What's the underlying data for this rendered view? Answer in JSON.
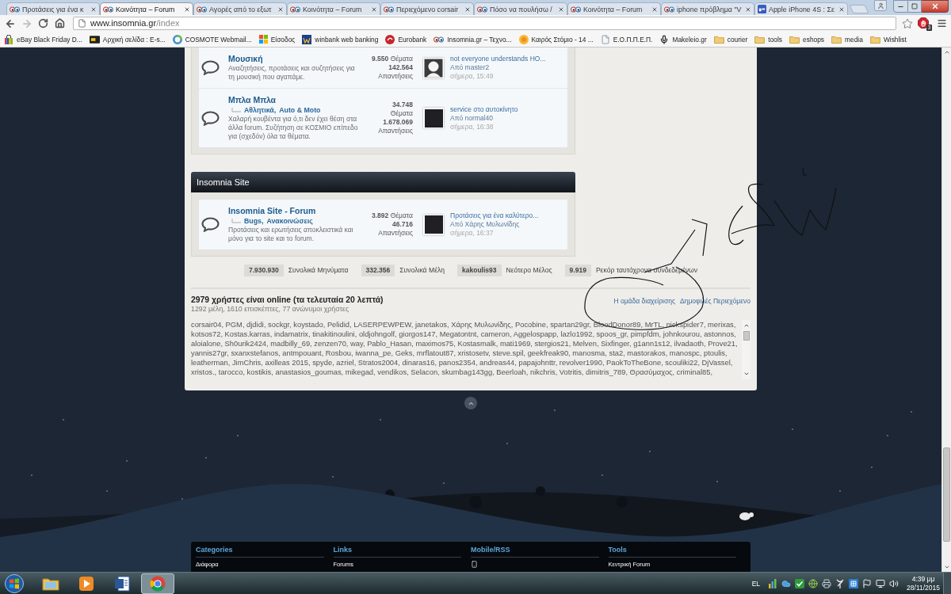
{
  "browser": {
    "tabs": [
      {
        "title": "Προτάσεις για ένα κ",
        "selected": false
      },
      {
        "title": "Κοινότητα – Forum",
        "selected": true
      },
      {
        "title": "Αγορές από το εξωτ",
        "selected": false
      },
      {
        "title": "Κοινότητα – Forum",
        "selected": false
      },
      {
        "title": "Περιεχόμενο corsair",
        "selected": false
      },
      {
        "title": "Πόσο να πουλήσω /",
        "selected": false
      },
      {
        "title": "Κοινότητα – Forum",
        "selected": false
      },
      {
        "title": "iphone πρόβλημα \"V",
        "selected": false
      },
      {
        "title": "Apple iPhone 4S : Σε",
        "selected": false
      }
    ],
    "address": {
      "host": "www.insomnia.gr",
      "path": "/index"
    },
    "extension_badge": "3",
    "bookmarks": [
      {
        "label": "eBay Black Friday D...",
        "kind": "link"
      },
      {
        "label": "Αρχική σελίδα : E-s...",
        "kind": "link"
      },
      {
        "label": "COSMOTE Webmail...",
        "kind": "link"
      },
      {
        "label": "Είσοδος",
        "kind": "link"
      },
      {
        "label": "winbank web banking",
        "kind": "link"
      },
      {
        "label": "Eurobank",
        "kind": "link"
      },
      {
        "label": "Insomnia.gr – Τεχνο...",
        "kind": "link"
      },
      {
        "label": "Καιρός Στόμιο - 14 ...",
        "kind": "link"
      },
      {
        "label": "Ε.Ο.Π.Π.Ε.Π.",
        "kind": "link"
      },
      {
        "label": "Makeleio.gr",
        "kind": "link"
      },
      {
        "label": "courier",
        "kind": "folder"
      },
      {
        "label": "tools",
        "kind": "folder"
      },
      {
        "label": "eshops",
        "kind": "folder"
      },
      {
        "label": "media",
        "kind": "folder"
      },
      {
        "label": "Wishlist",
        "kind": "folder"
      }
    ]
  },
  "forum_groups": [
    {
      "forums": [
        {
          "title": "Μουσική",
          "description": "Αναζητήσεις, προτάσεις και συζητήσεις για τη μουσική που αγαπάμε.",
          "topics": "**9.550** Θέματα",
          "replies": "**142.564** Απαντήσεις",
          "last_post": {
            "kind": "silhouette",
            "title": "not everyone understands HO...",
            "author": "Από master2",
            "time": "σήμερα, 15:49"
          }
        },
        {
          "title": "Μπλα Μπλα",
          "subforums": [
            "Αθλητικά,",
            "Auto & Moto"
          ],
          "description": "Χαλαρή κουβέντα για ό,τι δεν έχει θέση στα άλλα forum. Συζήτηση σε ΚΟΣΜΙΟ επίπεδο για (σχεδόν) όλα τα θέματα.",
          "topics": "**34.748** Θέματα",
          "replies": "**1.678.069** Απαντήσεις",
          "last_post": {
            "kind": "photo",
            "title": "service στο αυτοκίνητο",
            "author": "Από normal40",
            "time": "σήμερα, 16:38"
          }
        }
      ]
    },
    {
      "title": "Insomnia Site",
      "forums": [
        {
          "title": "Insomnia Site - Forum",
          "subforums": [
            "Bugs,",
            "Ανακοινώσεις"
          ],
          "description": "Προτάσεις και ερωτήσεις αποκλειστικά και μόνο για το site και το forum.",
          "topics": "**3.892** Θέματα",
          "replies": "**46.716** Απαντήσεις",
          "last_post": {
            "kind": "photo",
            "title": "Προτάσεις για ένα καλύτερο...",
            "author": "Από Χάρης Μυλωνίδης",
            "time": "σήμερα, 16:37"
          }
        }
      ]
    }
  ],
  "stats": [
    {
      "value": "7.930.930",
      "label": "Συνολικά Μηνύματα"
    },
    {
      "value": "332.356",
      "label": "Συνολικά Μέλη"
    },
    {
      "value": "kakoulis93",
      "label": "Νεότερο Μέλος"
    },
    {
      "value": "9.919",
      "label": "Ρεκόρ ταυτόχρονα συνδεδεμένων"
    }
  ],
  "online": {
    "title": "2979 χρήστες είναι online (τα τελευταία 20 λεπτά)",
    "summary": "1292 μέλη, 1610 επισκέπτες, 77 ανώνυμοι χρήστες",
    "links": [
      "Η ομάδα διαχείρισης",
      "Δημοφιλές Περιεχόμενο"
    ],
    "users": "corsair04, PGM, djdidi, sockgr, koystado, Pelidid, LASERPEWPEW, janetakos, Χάρης Μυλωνίδης, Pocobine, spartan29gr, BloodDonor89, MrTL, nickspider7, merixas, kotsos72, Kostas.karras, indamatrix, tinakitinoulini, oldjohngolf, giorgos147, Megatontnt, cameron, Aggelospapp, lazlo1992, spoos_gr, pimpfdm, johnkourou, astonnos, aloialone, Sh0urik2424, madbilly_69, zenzen70, way, Pablo_Hasan, maximos75, Kostasmalk, mati1969, stergios21, Melven, Sixfinger, g1ann1s12, ilvadaoth, Prove21, yannis27gr, sxanxstefanos, antmpouant, Rosbou, iwanna_pe, Geks, mrflatout87, xristosetv, steve.spil, geekfreak90, manosma, sta2, mastorakos, manospc, ptoulis, leatherman, JimChris, axilleas 2015, spyde, azriel, Stratos2004, dinaras16, panos2354, andreas44, papajohnttr, revolver1990, PaokToTheBone, scouliki22, DjVassel, xristos., tarocco, kostikis, anastasios_goumas, mikegad, vendikos, Selacon, skumbag143gg, Beerloah, nikchris, Votritis, dimitris_789, Θρασύμαχος, criminal85,"
  },
  "footer": [
    {
      "heading": "Categories",
      "kind": "links",
      "items": [
        "Διάφορα"
      ]
    },
    {
      "heading": "Links",
      "kind": "links",
      "items": [
        "Forums"
      ]
    },
    {
      "heading": "Mobile/RSS",
      "kind": "mobile"
    },
    {
      "heading": "Tools",
      "kind": "links",
      "items": [
        "Κεντρική Forum"
      ]
    }
  ],
  "taskbar": {
    "apps": [
      {
        "selected": false
      },
      {
        "selected": false
      },
      {
        "selected": false
      },
      {
        "selected": true
      }
    ],
    "language": "EL",
    "time": "4:39 μμ",
    "date": "28/11/2015"
  }
}
